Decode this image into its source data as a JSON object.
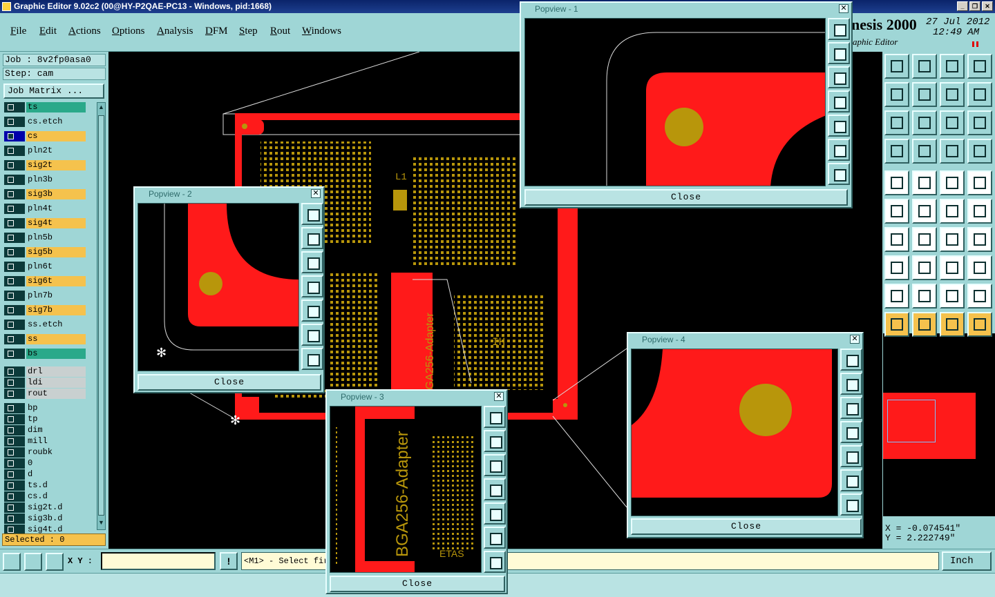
{
  "window": {
    "title": "Graphic Editor 9.02c2 (00@HY-P2QAE-PC13 - Windows, pid:1668)"
  },
  "menu": [
    "File",
    "Edit",
    "Actions",
    "Options",
    "Analysis",
    "DFM",
    "Step",
    "Rout",
    "Windows"
  ],
  "brand": {
    "name": "nesis 2000",
    "subtitle": "aphic Editor",
    "date": "27 Jul 2012",
    "time": "12:49 AM"
  },
  "job": {
    "job_label": "Job : 8v2fp0asa0",
    "step_label": "Step: cam",
    "matrix_button": "Job Matrix ..."
  },
  "layers": [
    {
      "name": "ts",
      "color": "#2aa98a"
    },
    {
      "name": "cs.etch",
      "color": "#9fd6d6"
    },
    {
      "name": "cs",
      "color": "#f5c24d",
      "active": true
    },
    {
      "name": "pln2t",
      "color": "#9fd6d6"
    },
    {
      "name": "sig2t",
      "color": "#f5c24d"
    },
    {
      "name": "pln3b",
      "color": "#9fd6d6"
    },
    {
      "name": "sig3b",
      "color": "#f5c24d"
    },
    {
      "name": "pln4t",
      "color": "#9fd6d6"
    },
    {
      "name": "sig4t",
      "color": "#f5c24d"
    },
    {
      "name": "pln5b",
      "color": "#9fd6d6"
    },
    {
      "name": "sig5b",
      "color": "#f5c24d"
    },
    {
      "name": "pln6t",
      "color": "#9fd6d6"
    },
    {
      "name": "sig6t",
      "color": "#f5c24d"
    },
    {
      "name": "pln7b",
      "color": "#9fd6d6"
    },
    {
      "name": "sig7b",
      "color": "#f5c24d"
    },
    {
      "name": "ss.etch",
      "color": "#9fd6d6"
    },
    {
      "name": "ss",
      "color": "#f5c24d"
    },
    {
      "name": "bs",
      "color": "#2aa98a"
    },
    {
      "name": "drl",
      "color": "#c9d0d0"
    },
    {
      "name": "ldi",
      "color": "#c9d0d0"
    },
    {
      "name": "rout",
      "color": "#c9d0d0"
    },
    {
      "name": "bp",
      "color": "#9fd6d6"
    },
    {
      "name": "tp",
      "color": "#9fd6d6"
    },
    {
      "name": "dim",
      "color": "#9fd6d6"
    },
    {
      "name": "mill",
      "color": "#9fd6d6"
    },
    {
      "name": "roubk",
      "color": "#9fd6d6"
    },
    {
      "name": "0",
      "color": "#9fd6d6"
    },
    {
      "name": "d",
      "color": "#9fd6d6"
    },
    {
      "name": "ts.d",
      "color": "#9fd6d6"
    },
    {
      "name": "cs.d",
      "color": "#9fd6d6"
    },
    {
      "name": "sig2t.d",
      "color": "#9fd6d6"
    },
    {
      "name": "sig3b.d",
      "color": "#9fd6d6"
    },
    {
      "name": "sig4t.d",
      "color": "#9fd6d6"
    }
  ],
  "selected": "Selected : 0",
  "bottom": {
    "xy_label": "X Y :",
    "xy_value": "",
    "message": "<M1> - Select fir",
    "units": "Inch"
  },
  "coords": {
    "x": "X = -0.074541\"",
    "y": "Y = 2.222749\""
  },
  "board_text": {
    "adapter": "BGA256-Adapter",
    "etas": "ETAS",
    "l1": "L1",
    "ih": "IH"
  },
  "popups": [
    {
      "title": "Popview - 1",
      "close": "Close"
    },
    {
      "title": "Popview - 2",
      "close": "Close"
    },
    {
      "title": "Popview - 3",
      "close": "Close"
    },
    {
      "title": "Popview - 4",
      "close": "Close"
    }
  ],
  "colors": {
    "pad": "#ff1a1a",
    "drill": "#b8960b",
    "panel": "#9fd6d6"
  }
}
